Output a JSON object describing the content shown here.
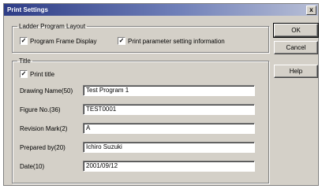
{
  "window": {
    "title": "Print Settings",
    "close_label": "x"
  },
  "layout_group": {
    "legend": "Ladder Program Layout",
    "program_frame": {
      "label": "Program Frame Display",
      "checked": true,
      "mark": "✓"
    },
    "print_params": {
      "label": "Print parameter setting information",
      "checked": true,
      "mark": "✓"
    }
  },
  "title_group": {
    "legend": "Title",
    "print_title": {
      "label": "Print title",
      "checked": true,
      "mark": "✓"
    },
    "fields": [
      {
        "label": "Drawing Name(50)",
        "value": "Test Program 1"
      },
      {
        "label": "Figure No.(36)",
        "value": "TEST0001"
      },
      {
        "label": "Revision Mark(2)",
        "value": "A"
      },
      {
        "label": "Prepared by(20)",
        "value": "Ichiro Suzuki"
      },
      {
        "label": "Date(10)",
        "value": "2001/09/12"
      }
    ]
  },
  "buttons": {
    "ok": "OK",
    "cancel": "Cancel",
    "help": "Help"
  }
}
